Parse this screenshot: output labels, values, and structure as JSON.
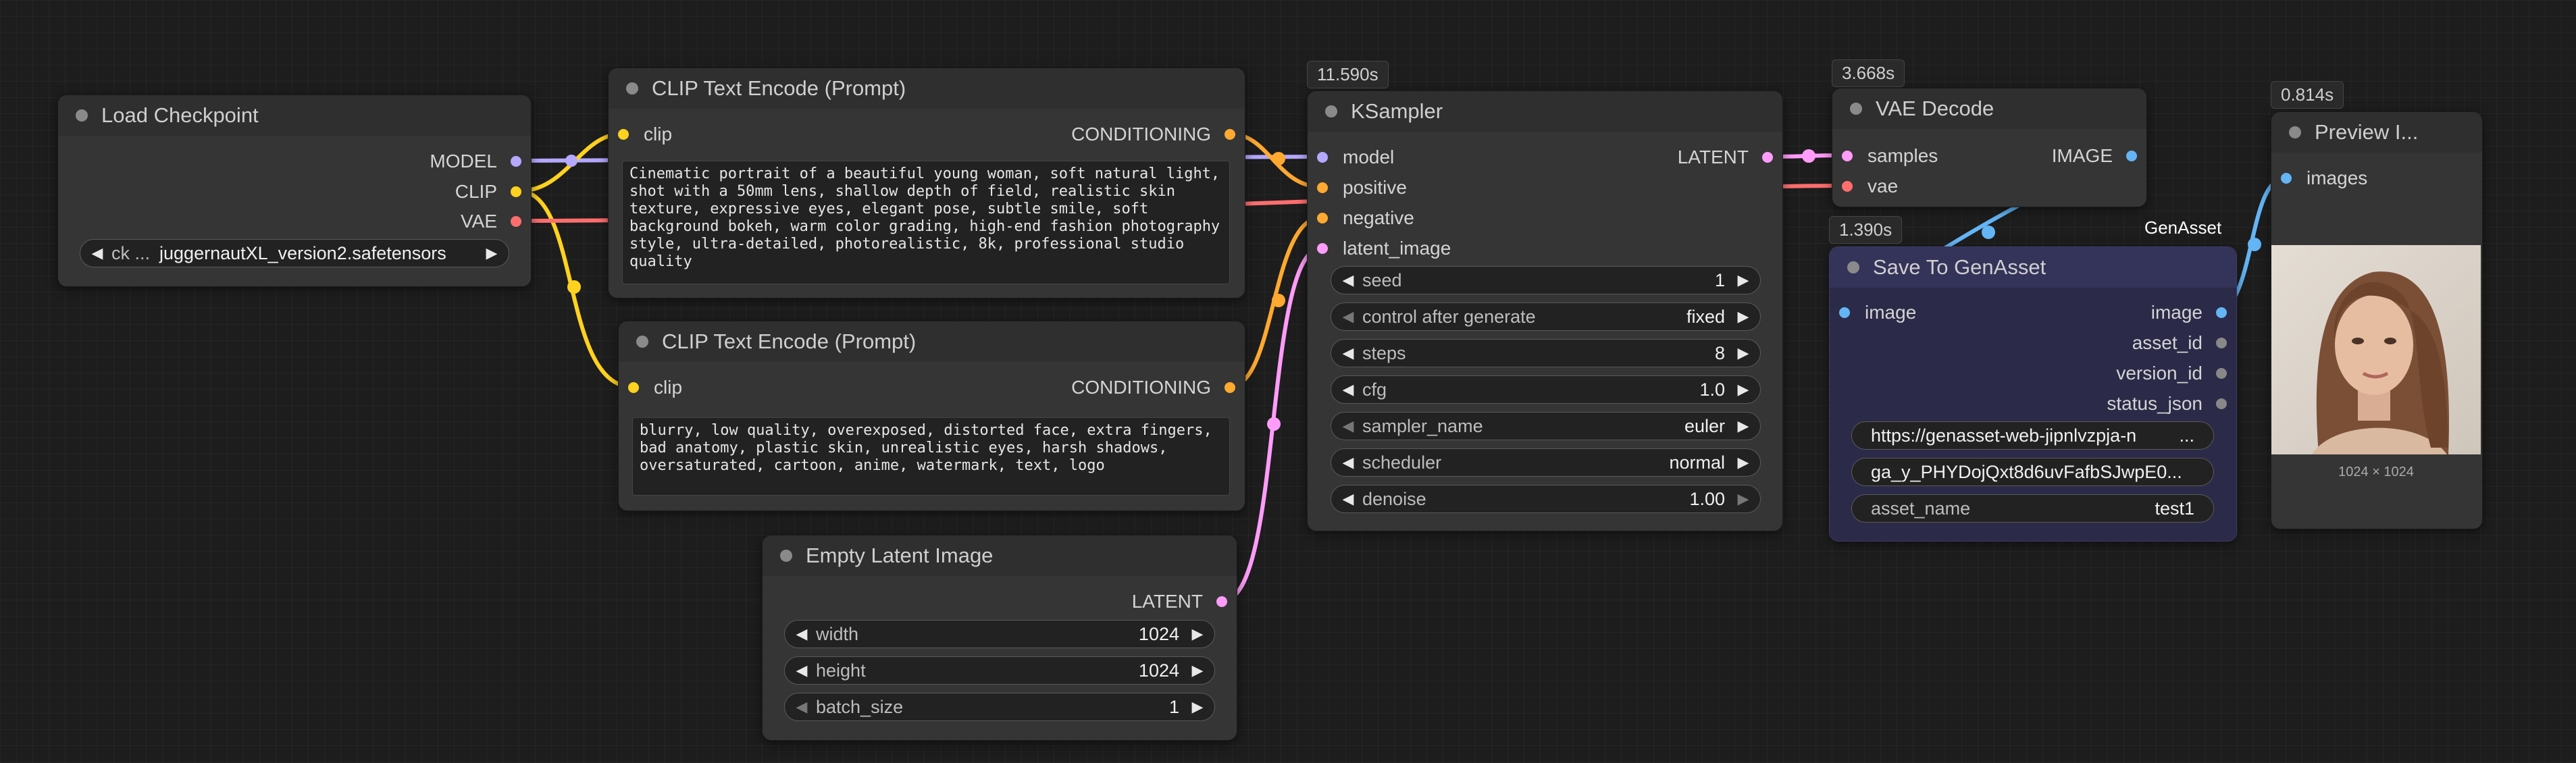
{
  "colors": {
    "model": "#b4a8ff",
    "clip": "#ffd21f",
    "vae": "#ff6e6e",
    "conditioning": "#ffa931",
    "latent": "#ff9cf9",
    "image": "#64b5f6"
  },
  "load_checkpoint": {
    "title": "Load Checkpoint",
    "outputs": [
      "MODEL",
      "CLIP",
      "VAE"
    ],
    "ckpt_label": "ck ...",
    "ckpt_value": "juggernautXL_version2.safetensors"
  },
  "clip_pos": {
    "title": "CLIP Text Encode (Prompt)",
    "input": "clip",
    "output": "CONDITIONING",
    "text": "Cinematic portrait of a beautiful young woman, soft natural light, shot with a 50mm lens, shallow depth of field, realistic skin texture, expressive eyes, elegant pose, subtle smile, soft background bokeh, warm color grading, high-end fashion photography style, ultra-detailed, photorealistic, 8k, professional studio quality"
  },
  "clip_neg": {
    "title": "CLIP Text Encode (Prompt)",
    "input": "clip",
    "output": "CONDITIONING",
    "text": "blurry, low quality, overexposed, distorted face, extra fingers, bad anatomy, plastic skin, unrealistic eyes, harsh shadows, oversaturated, cartoon, anime, watermark, text, logo"
  },
  "empty_latent": {
    "title": "Empty Latent Image",
    "output": "LATENT",
    "widgets": [
      {
        "label": "width",
        "value": "1024"
      },
      {
        "label": "height",
        "value": "1024"
      },
      {
        "label": "batch_size",
        "value": "1"
      }
    ]
  },
  "ksampler": {
    "timing": "11.590s",
    "title": "KSampler",
    "inputs": [
      "model",
      "positive",
      "negative",
      "latent_image"
    ],
    "output": "LATENT",
    "widgets": [
      {
        "label": "seed",
        "value": "1"
      },
      {
        "label": "control after generate",
        "value": "fixed"
      },
      {
        "label": "steps",
        "value": "8"
      },
      {
        "label": "cfg",
        "value": "1.0"
      },
      {
        "label": "sampler_name",
        "value": "euler"
      },
      {
        "label": "scheduler",
        "value": "normal"
      },
      {
        "label": "denoise",
        "value": "1.00"
      }
    ]
  },
  "vae_decode": {
    "timing": "3.668s",
    "title": "VAE Decode",
    "inputs": [
      "samples",
      "vae"
    ],
    "output": "IMAGE"
  },
  "save_genasset": {
    "timing": "1.390s",
    "badge": "GenAsset",
    "title": "Save To GenAsset",
    "input": "image",
    "outputs": [
      "image",
      "asset_id",
      "version_id",
      "status_json"
    ],
    "url_value": "https://genasset-web-jipnlvzpja-n",
    "url_suffix": "...",
    "token_value": "ga_y_PHYDojQxt8d6uvFafbSJwpE0...",
    "asset_label": "asset_name",
    "asset_value": "test1"
  },
  "preview": {
    "timing": "0.814s",
    "title": "Preview I...",
    "input": "images",
    "caption": "1024 × 1024"
  }
}
